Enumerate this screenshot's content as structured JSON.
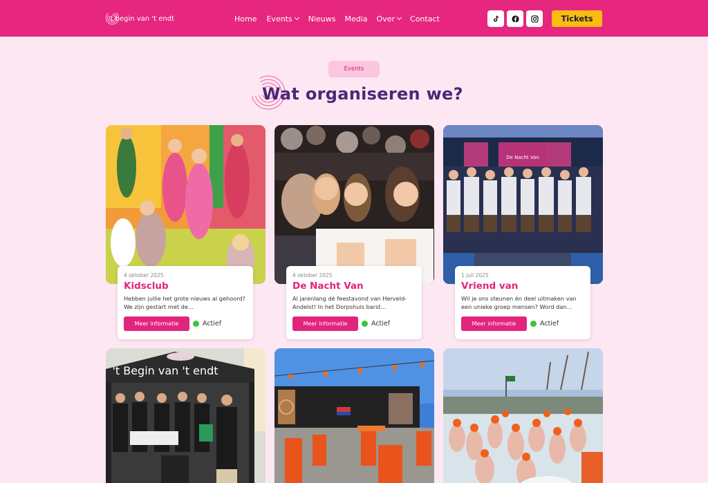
{
  "header": {
    "logo_text": "'t begin van 't endt",
    "nav": [
      {
        "label": "Home"
      },
      {
        "label": "Events"
      },
      {
        "label": "Nieuws"
      },
      {
        "label": "Media"
      },
      {
        "label": "Over"
      },
      {
        "label": "Contact"
      }
    ],
    "social_icons": [
      "tiktok-icon",
      "facebook-icon",
      "instagram-icon"
    ],
    "tickets_label": "Tickets"
  },
  "section": {
    "pill": "Events",
    "heading": "Wat organiseren we?"
  },
  "events": [
    {
      "date": "4 oktober 2025",
      "title": "Kidsclub",
      "description": "Hebben jullie het grote nieuws al gehoord? We zijn gestart met de…",
      "button": "Meer informatie",
      "status": "Actief"
    },
    {
      "date": "4 oktober 2025",
      "title": "De Nacht Van",
      "description": "Al jarenlang dé feestavond van Herveld-Andelst! In het Dorpshuis barst…",
      "button": "Meer informatie",
      "status": "Actief"
    },
    {
      "date": "1 juli 2025",
      "title": "Vriend van",
      "description": "Wil je ons steunen én deel uitmaken van een unieke groep mensen? Word dan…",
      "button": "Meer informatie",
      "status": "Actief"
    }
  ],
  "photo_texts": {
    "tent_banner": "'t Begin van 't endt",
    "stage_banner": "De Nacht Van"
  },
  "colors": {
    "brand_pink": "#e6267f",
    "ticket_yellow": "#f8bd10",
    "heading_purple": "#4b2779",
    "page_bg": "#fde7f2",
    "status_green": "#3cc33c"
  }
}
